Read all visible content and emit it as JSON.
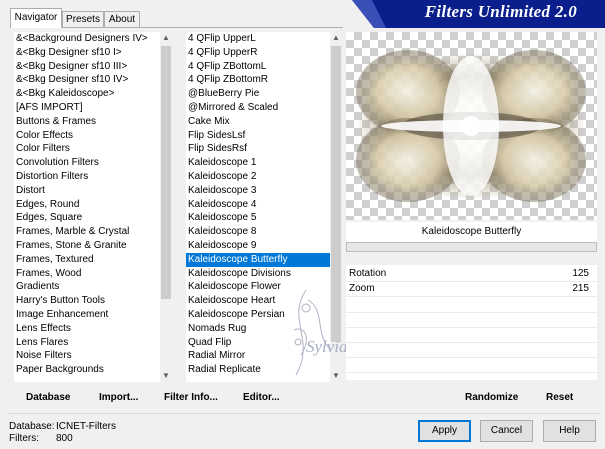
{
  "tabs": [
    "Navigator",
    "Presets",
    "About"
  ],
  "banner_title": "Filters Unlimited 2.0",
  "categories": [
    "&<Background Designers IV>",
    "&<Bkg Designer sf10 I>",
    "&<Bkg Designer sf10 III>",
    "&<Bkg Designer sf10 IV>",
    "&<Bkg Kaleidoscope>",
    "[AFS IMPORT]",
    "Buttons & Frames",
    "Color Effects",
    "Color Filters",
    "Convolution Filters",
    "Distortion Filters",
    "Distort",
    "Edges, Round",
    "Edges, Square",
    "Frames, Marble & Crystal",
    "Frames, Stone & Granite",
    "Frames, Textured",
    "Frames, Wood",
    "Gradients",
    "Harry's Button Tools",
    "Image Enhancement",
    "Lens Effects",
    "Lens Flares",
    "Noise Filters",
    "Paper Backgrounds"
  ],
  "filters": [
    "4 QFlip UpperL",
    "4 QFlip UpperR",
    "4 QFlip ZBottomL",
    "4 QFlip ZBottomR",
    "@BlueBerry Pie",
    "@Mirrored & Scaled",
    "Cake Mix",
    "Flip SidesLsf",
    "Flip SidesRsf",
    "Kaleidoscope 1",
    "Kaleidoscope 2",
    "Kaleidoscope 3",
    "Kaleidoscope 4",
    "Kaleidoscope 5",
    "Kaleidoscope 8",
    "Kaleidoscope 9",
    "Kaleidoscope Butterfly",
    "Kaleidoscope Divisions",
    "Kaleidoscope Flower",
    "Kaleidoscope Heart",
    "Kaleidoscope Persian",
    "Nomads Rug",
    "Quad Flip",
    "Radial Mirror",
    "Radial Replicate"
  ],
  "selected_filter": "Kaleidoscope Butterfly",
  "watermark": "Sylviane",
  "params": [
    {
      "label": "Rotation",
      "value": "125"
    },
    {
      "label": "Zoom",
      "value": "215"
    }
  ],
  "bottom_links": {
    "database": "Database",
    "import": "Import...",
    "filter_info": "Filter Info...",
    "editor": "Editor...",
    "randomize": "Randomize",
    "reset": "Reset"
  },
  "status": {
    "database_label": "Database:",
    "database_value": "ICNET-Filters",
    "filters_label": "Filters:",
    "filters_value": "800"
  },
  "buttons": {
    "apply": "Apply",
    "cancel": "Cancel",
    "help": "Help"
  },
  "colors": {
    "selection": "#0078d7",
    "banner": "#0b1f8c"
  }
}
